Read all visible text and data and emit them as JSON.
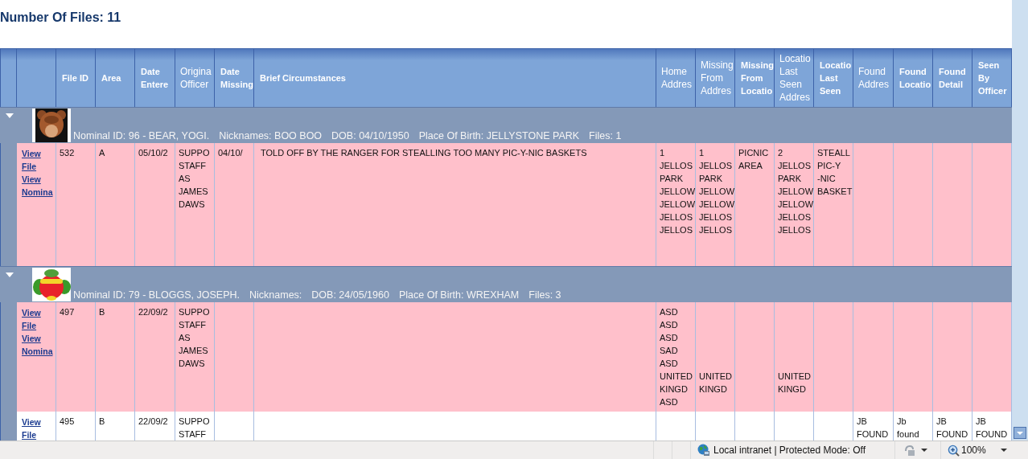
{
  "page_title": "Number Of Files: 11",
  "table": {
    "columns": [
      {
        "label": "File ID",
        "bold": true
      },
      {
        "label": "Area",
        "bold": true
      },
      {
        "label": "Date Entere",
        "bold": true
      },
      {
        "label": "Origina Officer",
        "bold": false
      },
      {
        "label": "Date Missing",
        "bold": true
      },
      {
        "label": "Brief Circumstances",
        "bold": true
      },
      {
        "label": "Home Addres",
        "bold": false
      },
      {
        "label": "Missing From Addres",
        "bold": false
      },
      {
        "label": "Missing From Locatio",
        "bold": true
      },
      {
        "label": "Locatio Last Seen Addres",
        "bold": false
      },
      {
        "label": "Locatio Last Seen",
        "bold": true
      },
      {
        "label": "Found Addres",
        "bold": false
      },
      {
        "label": "Found Locatio",
        "bold": true
      },
      {
        "label": "Found Detail",
        "bold": true
      },
      {
        "label": "Seen By Officer",
        "bold": true
      }
    ],
    "groups": [
      {
        "expanded": true,
        "avatar": {
          "kind": "picture"
        },
        "nominal_id": "Nominal ID: 96 - BEAR, YOGI.",
        "nicknames": "Nicknames: BOO BOO",
        "dob": "DOB: 04/10/1950",
        "place_of_birth": "Place Of Birth: JELLYSTONE PARK",
        "files": "Files: 1",
        "rows": [
          {
            "highlighted": true,
            "links": [
              "View File",
              "View Nomina"
            ],
            "cells": [
              "532",
              "A",
              "05/10/2",
              "SUPPO\nSTAFF\nAS\nJAMES\nDAWS",
              "04/10/",
              "TOLD OFF BY THE RANGER FOR STEALLING TOO MANY PIC-Y-NIC BASKETS",
              "1\nJELLOS\nPARK\nJELLOW\nJELLOW\nJELLOS\nJELLOS",
              "1\nJELLOS\nPARK\nJELLOW\nJELLOW\nJELLOS\nJELLOS",
              "PICNIC\nAREA",
              "2\nJELLOS\nPARK\nJELLOW\nJELLOW\nJELLOS\nJELLOS",
              "STEALL\nPIC-Y\n-NIC\nBASKET",
              null,
              null,
              null,
              null
            ]
          }
        ]
      },
      {
        "expanded": true,
        "avatar": {
          "kind": "picture"
        },
        "nominal_id": "Nominal ID: 79 - BLOGGS, JOSEPH.",
        "nicknames": "Nicknames:",
        "dob": "DOB: 24/05/1960",
        "place_of_birth": "Place Of Birth: WREXHAM",
        "files": "Files: 3",
        "rows": [
          {
            "highlighted": true,
            "links": [
              "View File",
              "View Nomina"
            ],
            "cells": [
              "497",
              "B",
              "22/09/2",
              "SUPPO\nSTAFF\nAS\nJAMES\nDAWS",
              null,
              null,
              "ASD\nASD\nASD\nSAD\nASD\nUNITED\nKINGD\nASD",
              "\n\n\n\n\nUNITED\nKINGD",
              null,
              "\n\n\n\n\nUNITED\nKINGD",
              null,
              null,
              null,
              null,
              null
            ]
          },
          {
            "highlighted": false,
            "links": [
              "View File"
            ],
            "cells": [
              "495",
              "B",
              "22/09/2",
              "SUPPO\nSTAFF",
              null,
              null,
              null,
              null,
              null,
              null,
              null,
              "JB\nFOUND",
              "Jb\nfound",
              "JB\nFOUND",
              "JB\nFOUND"
            ]
          }
        ]
      }
    ]
  },
  "status_bar": {
    "zone": "Local intranet | Protected Mode: Off",
    "zoom": "100%"
  }
}
